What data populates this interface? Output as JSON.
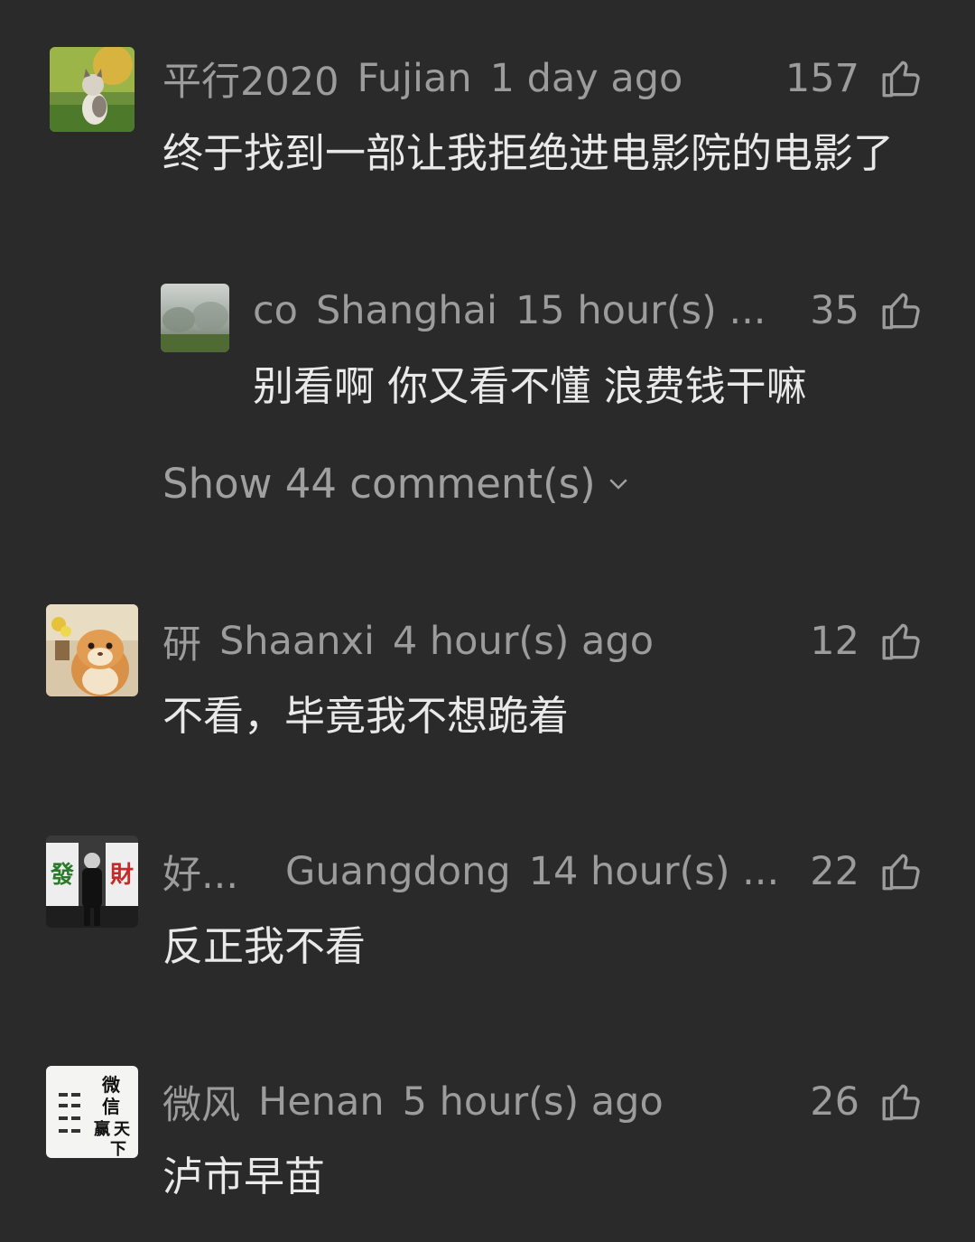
{
  "comments": [
    {
      "username": "平行2020",
      "location": "Fujian",
      "time": "1 day ago",
      "likes": "157",
      "text": "终于找到一部让我拒绝进电影院的电影了",
      "reply": {
        "username": "co",
        "location": "Shanghai",
        "time": "15 hour(s) ...",
        "likes": "35",
        "text": "别看啊 你又看不懂 浪费钱干嘛"
      },
      "show_more": "Show 44 comment(s)"
    },
    {
      "username": "研",
      "location": "Shaanxi",
      "time": "4 hour(s) ago",
      "likes": "12",
      "text": "不看，毕竟我不想跪着"
    },
    {
      "username": "好...",
      "location": "Guangdong",
      "time": "14 hour(s) ...",
      "likes": "22",
      "text": "反正我不看"
    },
    {
      "username": "微风",
      "location": "Henan",
      "time": "5 hour(s) ago",
      "likes": "26",
      "text": "泸市早苗"
    }
  ],
  "avatar_art": {
    "mahjong_left": "發",
    "mahjong_right": "財",
    "calligraphy": "微信赢天下"
  },
  "icons": {
    "like": "thumbs-up-icon",
    "expand": "chevron-down-icon"
  },
  "colors": {
    "background": "#2a2a2b",
    "text_primary": "#e9e9e9",
    "text_secondary": "#9c9c9c"
  }
}
